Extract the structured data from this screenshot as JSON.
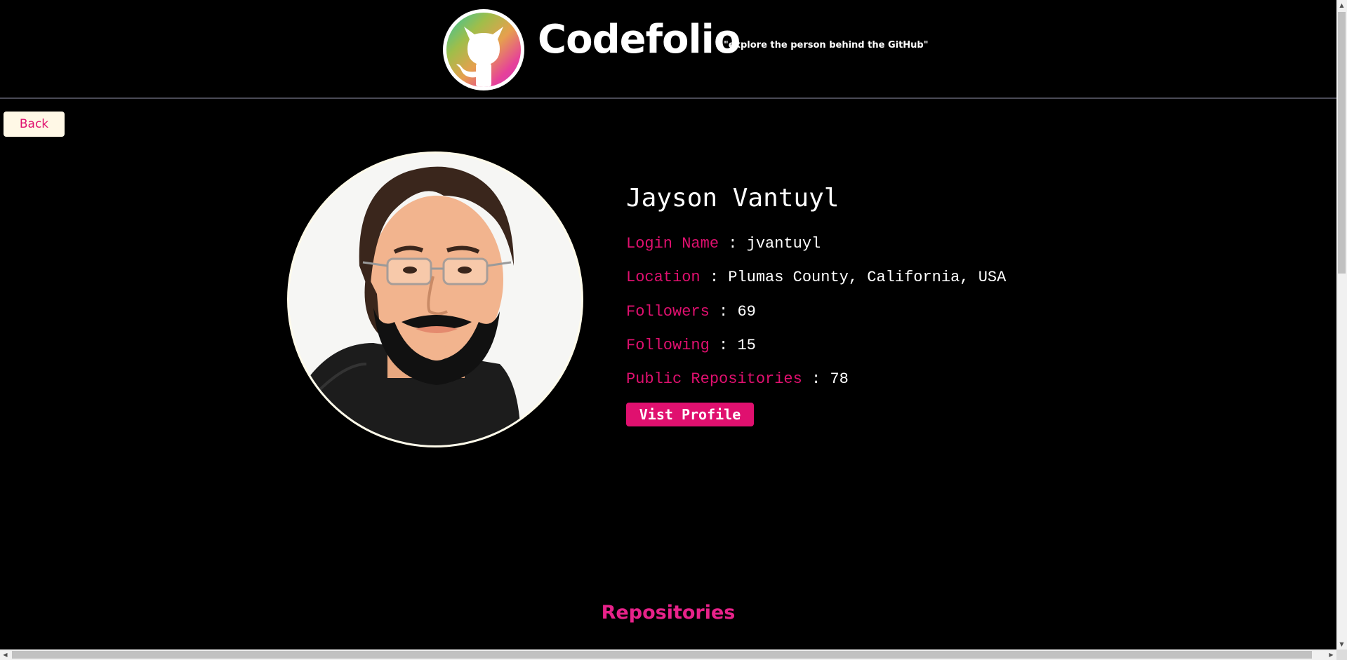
{
  "header": {
    "brand_name": "Codefolio",
    "tagline": "\"explore the person behind the GitHub\"",
    "logo_icon": "github-octocat-icon"
  },
  "nav": {
    "back_label": "Back"
  },
  "profile": {
    "name": "Jayson Vantuyl",
    "avatar_icon": "user-avatar",
    "fields": {
      "login": {
        "label": "Login Name",
        "sep": " : ",
        "value": "jvantuyl"
      },
      "location": {
        "label": "Location",
        "sep": " : ",
        "value": "Plumas County, California, USA"
      },
      "followers": {
        "label": "Followers",
        "sep": " : ",
        "value": "69"
      },
      "following": {
        "label": "Following",
        "sep": " : ",
        "value": "15"
      },
      "repos": {
        "label": "Public Repositories",
        "sep": " : ",
        "value": "78"
      }
    },
    "visit_label": "Vist Profile"
  },
  "sections": {
    "repositories_title": "Repositories"
  },
  "colors": {
    "accent": "#e0106f",
    "background": "#000000",
    "text": "#ffffff",
    "back_button_bg": "#fff8e6"
  }
}
